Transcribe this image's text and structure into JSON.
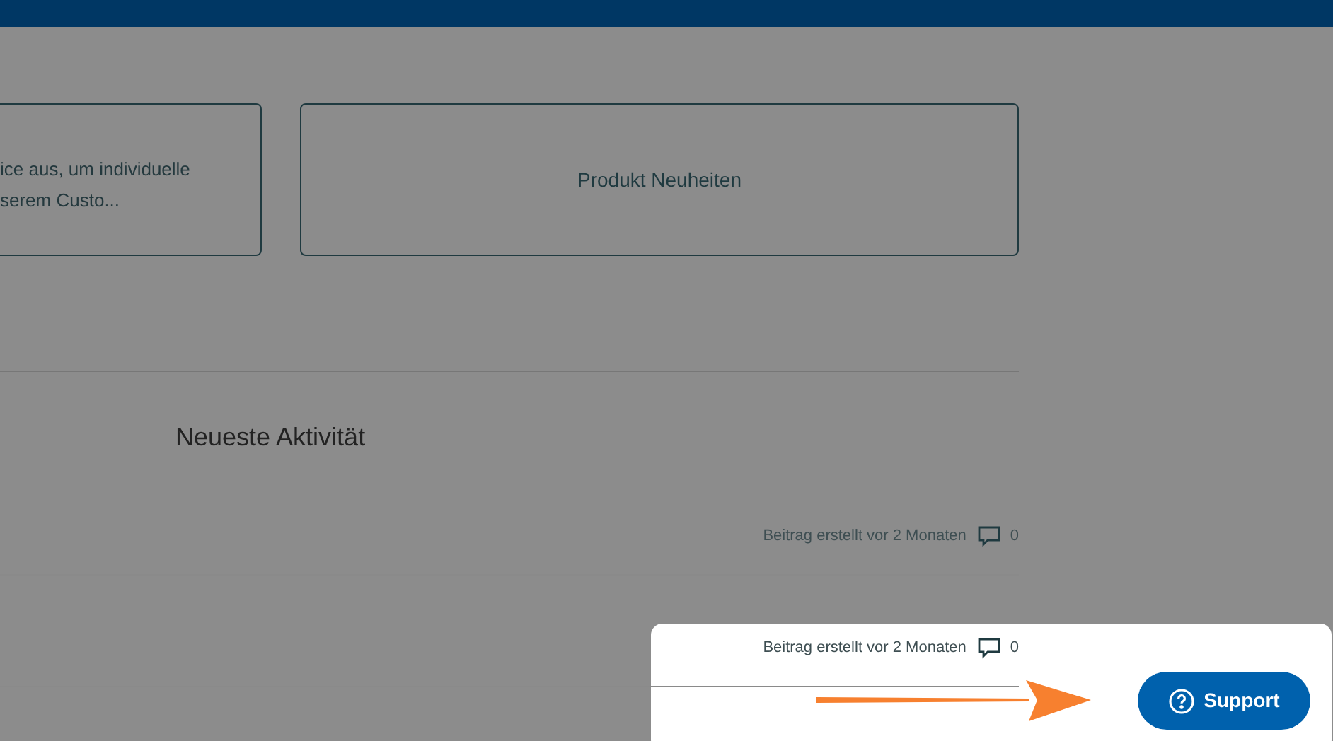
{
  "cards": [
    {
      "lines": [
        "ice aus, um individuelle",
        "serem Custo..."
      ]
    },
    {
      "title": "Produkt Neuheiten"
    }
  ],
  "activity": {
    "heading": "Neueste Aktivität",
    "posts": [
      {
        "meta": "Beitrag erstellt vor 2 Monaten",
        "comments": "0"
      },
      {
        "meta": "Beitrag erstellt vor 2 Monaten",
        "comments": "0"
      }
    ]
  },
  "support_button": {
    "label": "Support"
  }
}
